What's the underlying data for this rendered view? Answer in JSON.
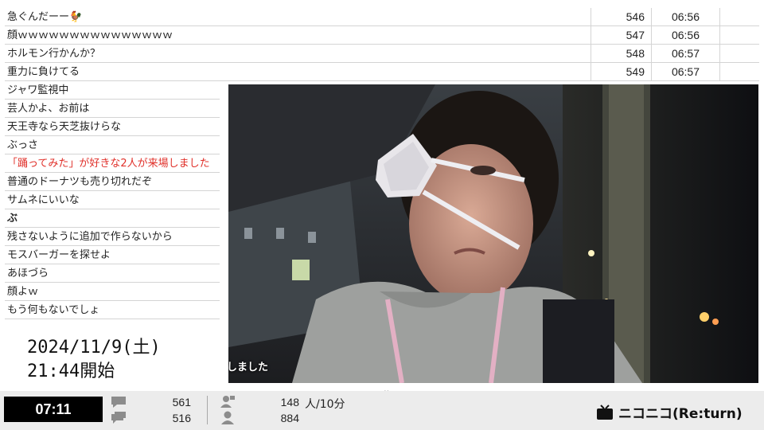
{
  "comments_table": [
    {
      "text": "急ぐんだーー🐓",
      "num": "546",
      "time": "06:56"
    },
    {
      "text": "顔ｗｗｗｗｗｗｗｗｗｗｗｗｗｗｗ",
      "num": "547",
      "time": "06:56"
    },
    {
      "text": "ホルモン行かんか？",
      "num": "548",
      "time": "06:57"
    },
    {
      "text": "重力に負けてる",
      "num": "549",
      "time": "06:57"
    }
  ],
  "comments_list": [
    {
      "text": "ジャワ監視中"
    },
    {
      "text": "芸人かよ、お前は"
    },
    {
      "text": "天王寺なら天芝抜けらな"
    },
    {
      "text": "ぶっさ"
    },
    {
      "text": "「踊ってみた」が好きな2人が来場しました",
      "highlight": true
    },
    {
      "text": "普通のドーナツも売り切れだぞ"
    },
    {
      "text": "サムネにいいな"
    },
    {
      "text": "ぶ",
      "bold": true
    },
    {
      "text": "残さないように追加で作らないから"
    },
    {
      "text": "モスバーガーを探せよ"
    },
    {
      "text": "あほづら"
    },
    {
      "text": "顔よｗ"
    },
    {
      "text": "もう何もないでしょ"
    }
  ],
  "video": {
    "subtitle": "しました"
  },
  "stream_info": {
    "date": "2024/11/9(土)",
    "start": "21:44開始"
  },
  "status_bar": {
    "elapsed": "07:11",
    "comments_a": "561",
    "comments_b": "516",
    "viewers_a": "148",
    "viewers_b": "884",
    "rate": "人/10分",
    "logo": "ニコニコ(Re:turn)"
  },
  "colors": {
    "highlight_comment": "#e0302a",
    "elapsed_bg": "#000000",
    "bar_bg": "#ececec"
  },
  "icons": [
    "comment-icon",
    "comments-icon",
    "viewer-icon",
    "user-icon",
    "tv-icon",
    "chevron-down-icon"
  ]
}
